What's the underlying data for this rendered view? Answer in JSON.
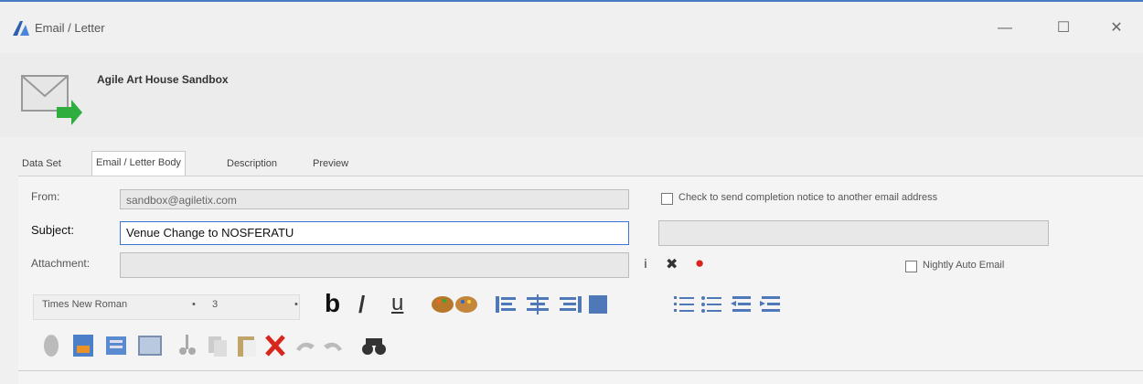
{
  "window": {
    "title": "Email / Letter",
    "minimize": "—",
    "maximize": "☐",
    "close": "✕"
  },
  "header": {
    "title": "Agile Art House Sandbox"
  },
  "tabs": [
    {
      "label": "Data Set"
    },
    {
      "label": "Email / Letter Body"
    },
    {
      "label": "Description"
    },
    {
      "label": "Preview"
    }
  ],
  "form": {
    "from_label": "From:",
    "from_value": "sandbox@agiletix.com",
    "subject_label": "Subject:",
    "subject_value": "Venue Change to NOSFERATU",
    "attachment_label": "Attachment:",
    "attachment_value": "",
    "completion_notice_label": "Check to send completion notice to another email address",
    "completion_email_value": "",
    "nightly_label": "Nightly Auto Email"
  },
  "attachment_icons": {
    "info": "i",
    "remove": "✖",
    "error": "●"
  },
  "editor": {
    "font_name": "Times New Roman",
    "font_size": "3",
    "bold": "b",
    "italic": "/",
    "underline": "u",
    "colors": {
      "delete_red": "#d9261c",
      "accent_blue": "#3b73d6",
      "titlebar_blue": "#4a79c4"
    }
  }
}
